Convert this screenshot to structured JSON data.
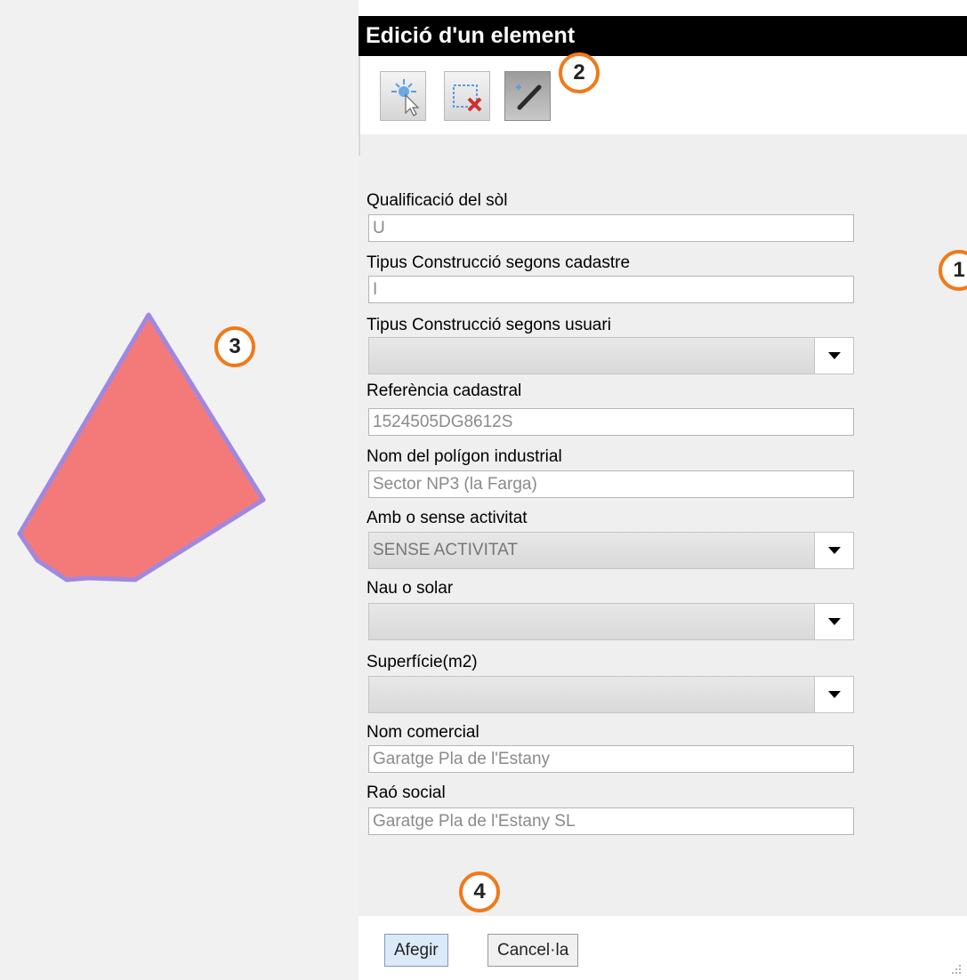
{
  "window": {
    "title": "Edició d'un element"
  },
  "toolbar": {
    "tools": [
      {
        "icon": "select-node-icon",
        "active": false
      },
      {
        "icon": "delete-selection-icon",
        "active": false
      },
      {
        "icon": "pencil-edit-icon",
        "active": true
      }
    ]
  },
  "callouts": {
    "one": "1",
    "two": "2",
    "three": "3",
    "four": "4"
  },
  "form": {
    "qualificacio": {
      "label": "Qualificació del sòl",
      "value": "U"
    },
    "tipus_cadastre": {
      "label": "Tipus Construcció segons cadastre",
      "value": "I"
    },
    "tipus_usuari": {
      "label": "Tipus Construcció segons usuari",
      "value": ""
    },
    "referencia": {
      "label": "Referència cadastral",
      "value": "1524505DG8612S"
    },
    "poligon": {
      "label": "Nom del polígon industrial",
      "value": "Sector NP3 (la Farga)"
    },
    "activitat": {
      "label": "Amb o sense activitat",
      "value": "SENSE ACTIVITAT"
    },
    "nau": {
      "label": "Nau o solar",
      "value": ""
    },
    "superficie": {
      "label": "Superfície(m2)",
      "value": ""
    },
    "comercial": {
      "label": "Nom comercial",
      "value": "Garatge Pla de l'Estany"
    },
    "social": {
      "label": "Raó social",
      "value": "Garatge Pla de l'Estany SL"
    }
  },
  "footer": {
    "add_label": "Afegir",
    "cancel_label": "Cancel·la"
  },
  "colors": {
    "polygon_fill": "#f47a7a",
    "polygon_stroke": "#a088e0",
    "callout": "#f07a1a"
  }
}
